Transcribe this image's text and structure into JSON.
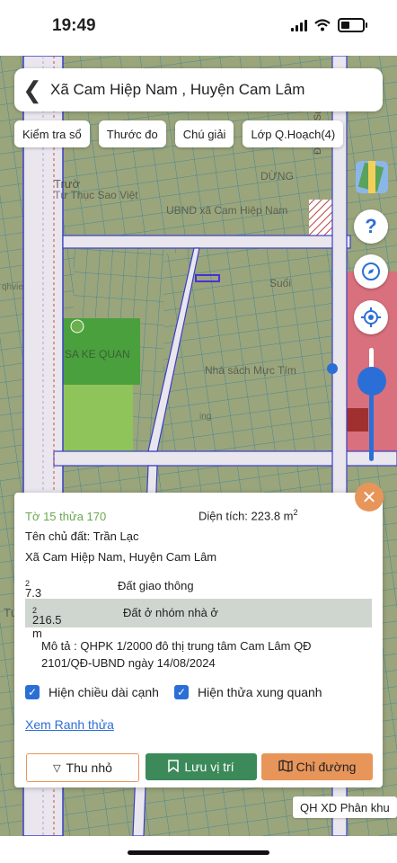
{
  "status": {
    "time": "19:49"
  },
  "header": {
    "title": "Xã Cam Hiệp Nam , Huyện Cam Lâm"
  },
  "toolbar": {
    "chips": [
      "Kiểm tra sổ",
      "Thước đo",
      "Chú giải",
      "Lớp Q.Hoạch(4)"
    ]
  },
  "map": {
    "labels": [
      "Trườ",
      "Tư Thục Sao Việt",
      "UBND xã Cam Hiệp Nam",
      "Đường Suối Mơ",
      "DỪNG",
      "SA KE QUAN",
      "Nhà sách Mực Tím",
      "Suối",
      "qhvie",
      "ing",
      "Tư"
    ],
    "colors": {
      "land": "#9aa57c",
      "parcel_line": "#2f7f9a",
      "road": "#e9e6ee",
      "road_edge": "#3b3fc4",
      "green": "#4aa03c",
      "pink": "#d9707d"
    },
    "icons": [
      "help-icon",
      "compass-icon",
      "locate-icon",
      "layers-icon",
      "layer-thumbnail-icon"
    ],
    "zoom_slider_level": 0.55
  },
  "parcel": {
    "id": "Tờ 15 thửa 170",
    "area_label": "Diện tích: 223.8 m",
    "area_sup": "2",
    "owner": "Tên chủ đất: Trần Lạc",
    "address": "Xã Cam Hiệp Nam, Huyện Cam Lâm",
    "usages": [
      {
        "area": "7.3 m",
        "sup": "2",
        "type": "Đất giao thông"
      },
      {
        "area": "216.5 m",
        "sup": "2",
        "type": "Đất ở nhóm nhà ở"
      }
    ],
    "description": "Mô tả : QHPK 1/2000 đô thị trung tâm Cam Lâm QĐ 2101/QĐ-UBND ngày 14/08/2024",
    "checkbox_edges": "Hiện chiều dài cạnh",
    "checkbox_neighbors": "Hiện thửa xung quanh",
    "link": "Xem Ranh thửa"
  },
  "actions": {
    "minimize": "Thu nhỏ",
    "save": "Lưu vị trí",
    "directions": "Chỉ đường"
  },
  "footer_tag": "QH XD Phân khu"
}
